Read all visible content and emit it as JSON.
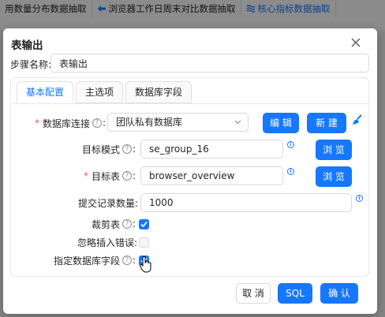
{
  "background": {
    "tabs": [
      {
        "label": "用数量分布数据抽取",
        "active": false
      },
      {
        "label": "浏览器工作日周末对比数据抽取",
        "active": false
      },
      {
        "label": "核心指标数据抽取",
        "active": true
      }
    ]
  },
  "dialog": {
    "title": "表输出",
    "step_name_label": "步骤名称:",
    "step_name_value": "表输出",
    "tabs": [
      {
        "label": "基本配置",
        "active": true
      },
      {
        "label": "主选项",
        "active": false
      },
      {
        "label": "数据库字段",
        "active": false
      }
    ],
    "form": {
      "db_connection": {
        "label": "数据库连接",
        "value": "团队私有数据库",
        "required": true
      },
      "target_schema": {
        "label": "目标模式",
        "value": "se_group_16"
      },
      "target_table": {
        "label": "目标表",
        "value": "browser_overview",
        "required": true
      },
      "commit_size": {
        "label": "提交记录数量:",
        "value": "1000"
      },
      "truncate_table": {
        "label": "裁剪表",
        "checked": true
      },
      "ignore_insert_errors": {
        "label": "忽略插入错误:",
        "checked": false,
        "disabled": true
      },
      "specify_db_fields": {
        "label": "指定数据库字段",
        "checked": true
      }
    },
    "buttons": {
      "edit": "编 辑",
      "new": "新 建",
      "browse_schema": "浏 览",
      "browse_table": "浏 览",
      "cancel": "取 消",
      "sql": "SQL",
      "confirm": "确 认"
    },
    "help_mark": "?",
    "info_mark": "i",
    "required_mark": "*",
    "colon": ":"
  },
  "colors": {
    "primary": "#1677ff",
    "required": "#ff4d4f",
    "mask": "rgba(0,0,0,0.45)"
  },
  "icons": {
    "close": "close-icon",
    "select_arrow": "chevron-down-icon",
    "broom": "broom-icon",
    "info": "info-circle-icon",
    "help": "question-circle-icon",
    "cursor": "hand-pointer-icon"
  }
}
